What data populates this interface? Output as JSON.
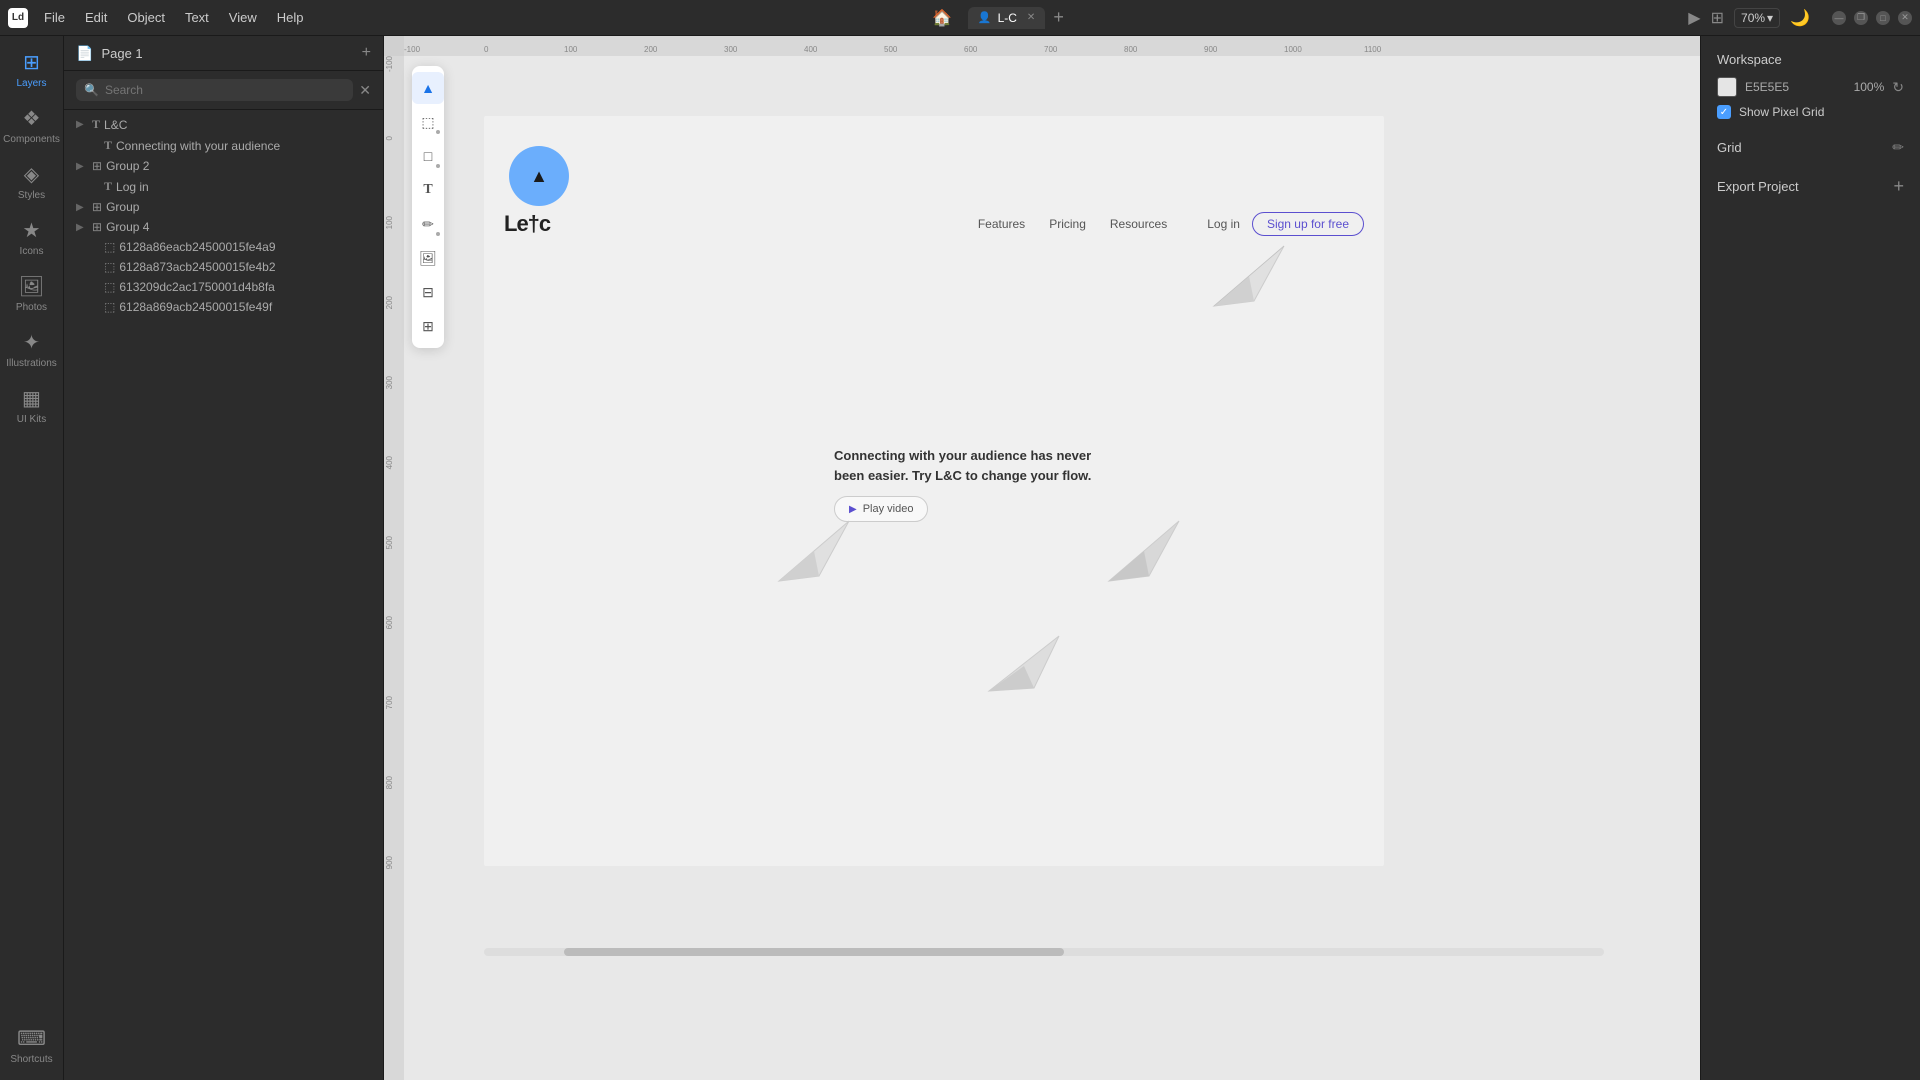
{
  "app": {
    "logo_label": "Ld",
    "title": "L-C"
  },
  "titlebar": {
    "menus": [
      "File",
      "Edit",
      "Object",
      "Text",
      "View",
      "Help"
    ],
    "home_icon": "🏠",
    "tab_icon": "👤",
    "tab_name": "L-C",
    "tab_add": "+",
    "zoom": "70%",
    "play_icon": "▶",
    "grid_icon": "⊞",
    "moon_icon": "🌙",
    "minimize": "—",
    "maximize": "□",
    "restore": "❐",
    "close": "✕"
  },
  "left_sidebar": {
    "layers_label": "Layers",
    "shortcuts_label": "Shortcuts",
    "components_label": "Components",
    "styles_label": "Styles",
    "icons_label": "Icons",
    "photos_label": "Photos",
    "illustrations_label": "Illustrations",
    "uikits_label": "UI Kits"
  },
  "left_panel": {
    "page_label": "Page 1",
    "page_icon": "📄",
    "search_placeholder": "Search",
    "close_icon": "✕",
    "layers": [
      {
        "indent": 0,
        "type": "text",
        "chevron": "▶",
        "name": "L&C"
      },
      {
        "indent": 1,
        "type": "text",
        "chevron": "",
        "name": "Connecting with your audience"
      },
      {
        "indent": 0,
        "type": "group",
        "chevron": "▶",
        "name": "Group 2"
      },
      {
        "indent": 1,
        "type": "text",
        "chevron": "",
        "name": "Log in"
      },
      {
        "indent": 0,
        "type": "group",
        "chevron": "▶",
        "name": "Group"
      },
      {
        "indent": 0,
        "type": "group",
        "chevron": "▶",
        "name": "Group 4"
      },
      {
        "indent": 1,
        "type": "image",
        "chevron": "",
        "name": "6128a86eacb24500015fe4a9"
      },
      {
        "indent": 1,
        "type": "image",
        "chevron": "",
        "name": "6128a873acb24500015fe4b2"
      },
      {
        "indent": 1,
        "type": "image",
        "chevron": "",
        "name": "613209dc2ac1750001d4b8fa"
      },
      {
        "indent": 1,
        "type": "image",
        "chevron": "",
        "name": "6128a869acb24500015fe49f"
      }
    ]
  },
  "canvas": {
    "ruler_labels": [
      "-100",
      "0",
      "100",
      "200",
      "300",
      "400",
      "500",
      "600",
      "700",
      "800",
      "900",
      "1000",
      "1100"
    ],
    "ruler_v_labels": [
      "-100",
      "0",
      "100",
      "200",
      "300",
      "400",
      "500",
      "600",
      "700",
      "800",
      "900"
    ],
    "tools": [
      {
        "name": "select",
        "icon": "▲",
        "active": true
      },
      {
        "name": "frame",
        "icon": "⬜",
        "active": false
      },
      {
        "name": "shape",
        "icon": "□",
        "active": false
      },
      {
        "name": "text",
        "icon": "T",
        "active": false
      },
      {
        "name": "pen",
        "icon": "✏",
        "active": false
      },
      {
        "name": "image",
        "icon": "🖼",
        "active": false
      },
      {
        "name": "layout",
        "icon": "⊟",
        "active": false
      },
      {
        "name": "grid",
        "icon": "⊞",
        "active": false
      }
    ]
  },
  "design_content": {
    "logo": "Le†c",
    "nav_links": [
      "Features",
      "Pricing",
      "Resources"
    ],
    "login_label": "Log in",
    "signup_label": "Sign up for free",
    "hero_title": "Connecting with your audience has never\nbeen easier. Try L&C to change your flow.",
    "play_video_label": "Play video"
  },
  "right_panel": {
    "workspace_label": "Workspace",
    "workspace_color": "E5E5E5",
    "workspace_opacity": "100%",
    "show_pixel_grid_label": "Show Pixel Grid",
    "grid_label": "Grid",
    "export_label": "Export Project"
  }
}
